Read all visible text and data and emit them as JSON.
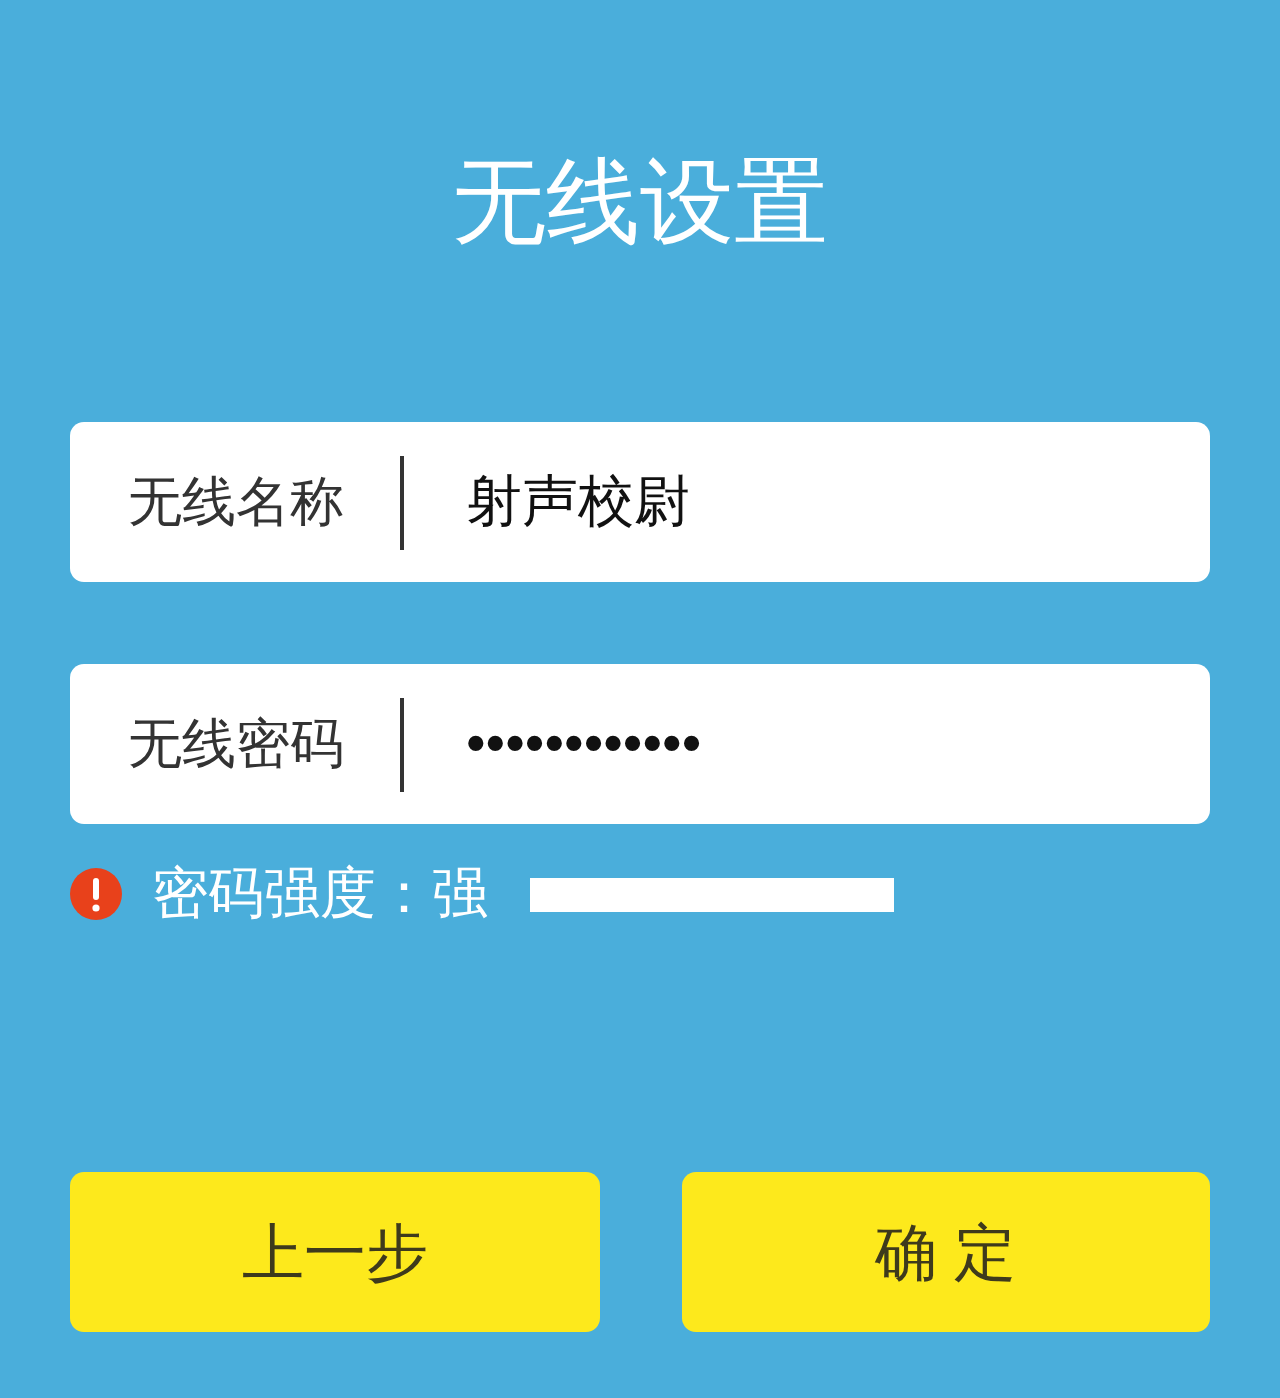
{
  "title": "无线设置",
  "fields": [
    {
      "label": "无线名称",
      "value": "射声校尉"
    },
    {
      "label": "无线密码",
      "value": "••••••••••••"
    }
  ],
  "password_strength": {
    "text": "密码强度：强",
    "level": 1
  },
  "buttons": [
    {
      "label": "上一步"
    },
    {
      "label": "确 定"
    }
  ]
}
